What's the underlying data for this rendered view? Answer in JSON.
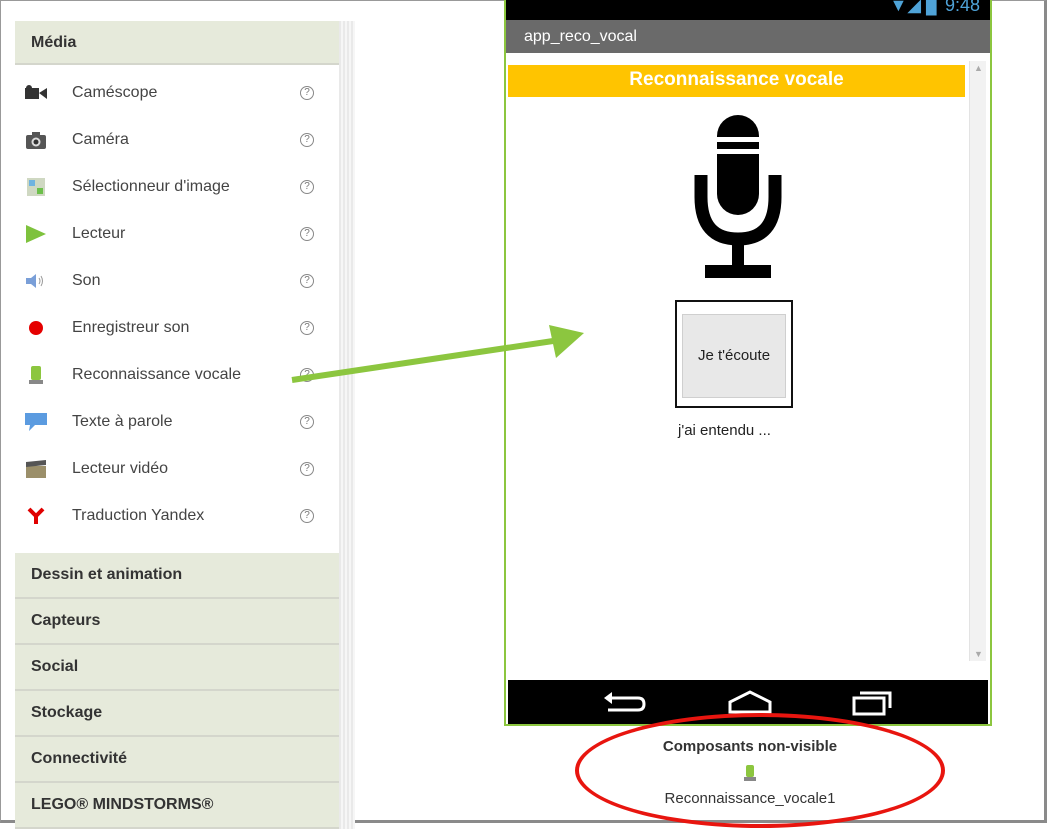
{
  "palette": {
    "open_category": "Média",
    "items": [
      {
        "label": "Caméscope",
        "icon": "camcorder-icon"
      },
      {
        "label": "Caméra",
        "icon": "camera-icon"
      },
      {
        "label": "Sélectionneur d'image",
        "icon": "image-picker-icon"
      },
      {
        "label": "Lecteur",
        "icon": "play-icon"
      },
      {
        "label": "Son",
        "icon": "speaker-icon"
      },
      {
        "label": "Enregistreur son",
        "icon": "record-icon"
      },
      {
        "label": "Reconnaissance vocale",
        "icon": "speech-recognizer-icon"
      },
      {
        "label": "Texte à parole",
        "icon": "speech-bubble-icon"
      },
      {
        "label": "Lecteur vidéo",
        "icon": "clapperboard-icon"
      },
      {
        "label": "Traduction Yandex",
        "icon": "yandex-icon"
      }
    ],
    "help_symbol": "?",
    "categories": [
      "Dessin et animation",
      "Capteurs",
      "Social",
      "Stockage",
      "Connectivité",
      "LEGO® MINDSTORMS®"
    ]
  },
  "phone": {
    "status_text": "▼◢ ▊ 9:48",
    "app_title": "app_reco_vocal",
    "screen_title": "Reconnaissance vocale",
    "button_label": "Je t'écoute",
    "result_label": "j'ai entendu ..."
  },
  "non_visible": {
    "title": "Composants non-visible",
    "component_name": "Reconnaissance_vocale1"
  },
  "colors": {
    "accent_green": "#8cc63f",
    "title_yellow": "#ffc400",
    "annotation_red": "#e8150f"
  }
}
